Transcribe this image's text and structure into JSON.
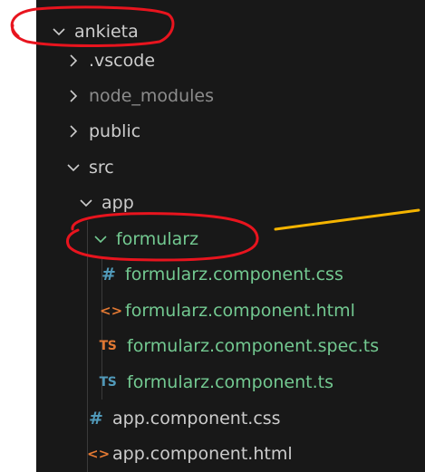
{
  "explorer": {
    "root": {
      "label": "ankieta",
      "expanded": true
    },
    "items": [
      {
        "label": ".vscode",
        "expanded": false
      },
      {
        "label": "node_modules",
        "expanded": false
      },
      {
        "label": "public",
        "expanded": false
      },
      {
        "label": "src",
        "expanded": true
      },
      {
        "label": "app",
        "expanded": true
      },
      {
        "label": "formularz",
        "expanded": true
      }
    ],
    "files": [
      {
        "label": "formularz.component.css",
        "icon": "css-hash-icon",
        "icon_glyph": "#"
      },
      {
        "label": "formularz.component.html",
        "icon": "html-brackets-icon",
        "icon_glyph": "<>"
      },
      {
        "label": "formularz.component.spec.ts",
        "icon": "typescript-spec-icon",
        "icon_glyph": "TS"
      },
      {
        "label": "formularz.component.ts",
        "icon": "typescript-icon",
        "icon_glyph": "TS"
      },
      {
        "label": "app.component.css",
        "icon": "css-hash-icon",
        "icon_glyph": "#"
      },
      {
        "label": "app.component.html",
        "icon": "html-brackets-icon",
        "icon_glyph": "<>"
      }
    ]
  },
  "colors": {
    "background": "#181818",
    "text": "#cccccc",
    "ignored_text": "#8c8c8c",
    "untracked_text": "#73c991",
    "annotation_red": "#e8141e",
    "annotation_arrow": "#f5b400"
  }
}
